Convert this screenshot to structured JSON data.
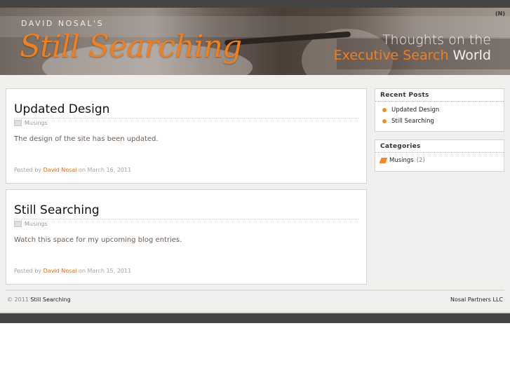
{
  "header": {
    "kicker": "DAVID NOSAL'S",
    "title": "Still Searching",
    "tagline_line1": "Thoughts on the",
    "tagline_highlight": "Executive Search",
    "tagline_end": "World",
    "logo_mark": "(N)"
  },
  "posts": [
    {
      "title": "Updated Design",
      "category": "Musings",
      "body": "The design of the site has been updated.",
      "posted_by_prefix": "Posted by",
      "author": "David Nosal",
      "date_prefix": "on",
      "date": "March 16, 2011"
    },
    {
      "title": "Still Searching",
      "category": "Musings",
      "body": "Watch this space for my upcoming blog entries.",
      "posted_by_prefix": "Posted by",
      "author": "David Nosal",
      "date_prefix": "on",
      "date": "March 15, 2011"
    }
  ],
  "sidebar": {
    "recent_posts": {
      "title": "Recent Posts",
      "items": [
        "Updated Design",
        "Still Searching"
      ]
    },
    "categories": {
      "title": "Categories",
      "items": [
        {
          "label": "Musings",
          "count": "(2)"
        }
      ]
    }
  },
  "footer": {
    "copyright": "© 2011",
    "site_name": "Still Searching",
    "company": "Nosal Partners LLC"
  },
  "colors": {
    "accent": "#f07f20",
    "dark_bar": "#444444",
    "content_bg": "#f1f0ee"
  }
}
